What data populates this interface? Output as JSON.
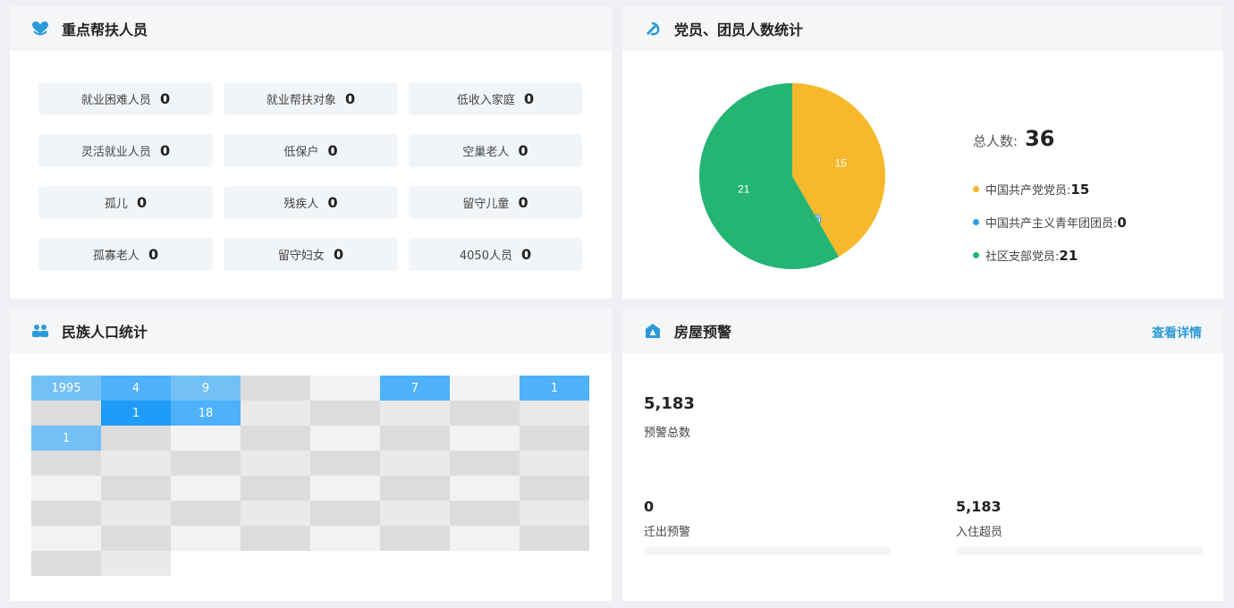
{
  "support": {
    "title": "重点帮扶人员",
    "items": [
      {
        "label": "就业困难人员",
        "value": "0"
      },
      {
        "label": "就业帮扶对象",
        "value": "0"
      },
      {
        "label": "低收入家庭",
        "value": "0"
      },
      {
        "label": "灵活就业人员",
        "value": "0"
      },
      {
        "label": "低保户",
        "value": "0"
      },
      {
        "label": "空巢老人",
        "value": "0"
      },
      {
        "label": "孤儿",
        "value": "0"
      },
      {
        "label": "残疾人",
        "value": "0"
      },
      {
        "label": "留守儿童",
        "value": "0"
      },
      {
        "label": "孤寡老人",
        "value": "0"
      },
      {
        "label": "留守妇女",
        "value": "0"
      },
      {
        "label": "4050人员",
        "value": "0"
      }
    ]
  },
  "party": {
    "title": "党员、团员人数统计",
    "total_label": "总人数:",
    "total_value": "36",
    "legend": [
      {
        "label": "中国共产党党员:",
        "value": "15",
        "color": "#f7b92b"
      },
      {
        "label": "中国共产主义青年团团员:",
        "value": "0",
        "color": "#2f9bea"
      },
      {
        "label": "社区支部党员:",
        "value": "21",
        "color": "#24b573"
      }
    ]
  },
  "chart_data": {
    "type": "pie",
    "title": "",
    "series": [
      {
        "name": "中国共产党党员",
        "value": 15,
        "color": "#f7b92b"
      },
      {
        "name": "中国共产主义青年团团员",
        "value": 0,
        "color": "#2f9bea"
      },
      {
        "name": "社区支部党员",
        "value": 21,
        "color": "#24b573"
      }
    ]
  },
  "ethnic": {
    "title": "民族人口统计",
    "labels": [
      "1995",
      "4",
      "9",
      "7",
      "1",
      "1",
      "18",
      "1"
    ]
  },
  "housing": {
    "title": "房屋预警",
    "link": "查看详情",
    "total_value": "5,183",
    "total_label": "预警总数",
    "move_out_value": "0",
    "move_out_label": "迁出预警",
    "move_out_fraction": 0,
    "overcrowd_value": "5,183",
    "overcrowd_label": "入住超员",
    "overcrowd_fraction": 0
  },
  "colors": {
    "accent": "#2a9ad9",
    "heat_light": "#73c0f7",
    "heat_mid": "#4eb1f9",
    "heat_dark": "#1f9cf7"
  }
}
